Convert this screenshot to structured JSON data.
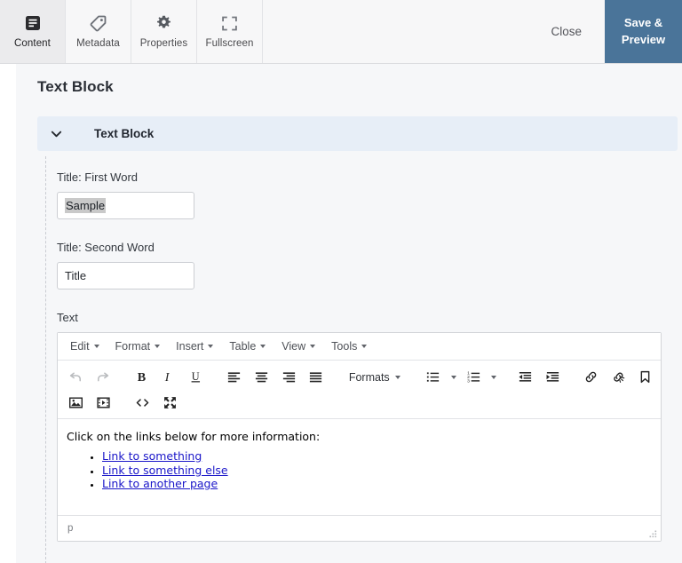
{
  "topbar": {
    "tabs": [
      {
        "label": "Content",
        "icon": "content-lines-icon",
        "active": true
      },
      {
        "label": "Metadata",
        "icon": "tag-icon",
        "active": false
      },
      {
        "label": "Properties",
        "icon": "gear-icon",
        "active": false
      },
      {
        "label": "Fullscreen",
        "icon": "expand-icon",
        "active": false
      }
    ],
    "close_label": "Close",
    "save_label": "Save & Preview",
    "save_line1": "Save &",
    "save_line2": "Preview",
    "accent_color": "#4a7499"
  },
  "page": {
    "title": "Text Block"
  },
  "block": {
    "header_title": "Text Block",
    "header_color": "#e7eef7",
    "chevron_icon": "chevron-down-icon",
    "fields": [
      {
        "label": "Title: First Word",
        "value": "Sample",
        "selected": true
      },
      {
        "label": "Title: Second Word",
        "value": "Title",
        "selected": false
      }
    ],
    "editor_label": "Text"
  },
  "editor": {
    "menubar": [
      "Edit",
      "Format",
      "Insert",
      "Table",
      "View",
      "Tools"
    ],
    "toolbar_row1": [
      {
        "name": "undo-icon",
        "label": "Undo",
        "disabled": true
      },
      {
        "name": "redo-icon",
        "label": "Redo",
        "disabled": true
      },
      {
        "name": "bold-icon",
        "label": "Bold"
      },
      {
        "name": "italic-icon",
        "label": "Italic"
      },
      {
        "name": "underline-icon",
        "label": "Underline"
      },
      {
        "name": "align-left-icon",
        "label": "Align left"
      },
      {
        "name": "align-center-icon",
        "label": "Align center"
      },
      {
        "name": "align-right-icon",
        "label": "Align right"
      },
      {
        "name": "align-justify-icon",
        "label": "Justify"
      }
    ],
    "formats_label": "Formats",
    "toolbar_row1_tail": [
      {
        "name": "bullet-list-icon",
        "label": "Bullet list"
      },
      {
        "name": "numbered-list-icon",
        "label": "Numbered list"
      },
      {
        "name": "outdent-icon",
        "label": "Decrease indent"
      },
      {
        "name": "indent-icon",
        "label": "Increase indent"
      },
      {
        "name": "link-icon",
        "label": "Insert/edit link"
      },
      {
        "name": "unlink-icon",
        "label": "Remove link"
      },
      {
        "name": "anchor-icon",
        "label": "Anchor"
      }
    ],
    "toolbar_row2": [
      {
        "name": "image-icon",
        "label": "Insert/edit image"
      },
      {
        "name": "media-icon",
        "label": "Insert/edit media"
      },
      {
        "name": "source-code-icon",
        "label": "Source code"
      },
      {
        "name": "fullscreen-icon",
        "label": "Fullscreen"
      }
    ],
    "content": {
      "intro": "Click on the links below for more information:",
      "links": [
        "Link to something",
        "Link to something else",
        "Link to another page"
      ],
      "link_color": "#1a16c9"
    },
    "statusbar_path": "p",
    "resize_handle": "resize-grip-icon"
  }
}
